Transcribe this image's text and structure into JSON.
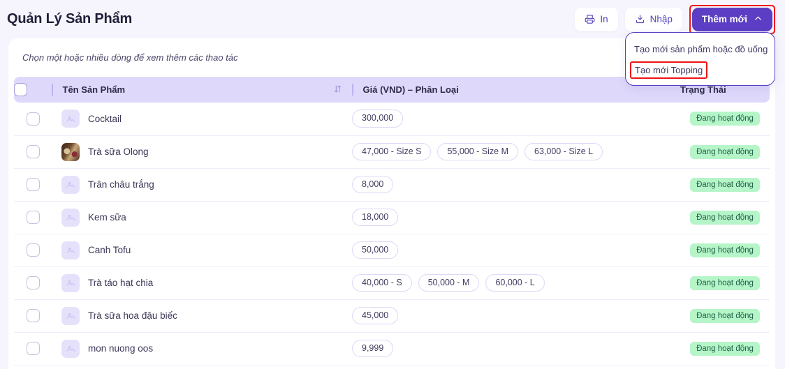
{
  "header": {
    "title": "Quản Lý Sản Phẩm",
    "print_label": "In",
    "import_label": "Nhập",
    "add_new_label": "Thêm mới"
  },
  "dropdown": {
    "items": [
      {
        "label": "Tạo mới sản phẩm hoặc đồ uống",
        "highlighted": false
      },
      {
        "label": "Tạo mới Topping",
        "highlighted": true
      }
    ]
  },
  "card": {
    "hint": "Chọn một hoặc nhiều dòng để xem thêm các thao tác"
  },
  "table": {
    "columns": {
      "name": "Tên Sản Phẩm",
      "price": "Giá (VND) – Phân Loại",
      "status": "Trạng Thái"
    },
    "rows": [
      {
        "name": "Cocktail",
        "thumb": "placeholder",
        "prices": [
          "300,000"
        ],
        "status": "Đang hoạt động"
      },
      {
        "name": "Trà sữa Olong",
        "thumb": "photo",
        "prices": [
          "47,000 - Size S",
          "55,000 - Size M",
          "63,000 - Size L"
        ],
        "status": "Đang hoạt động"
      },
      {
        "name": "Trân châu trắng",
        "thumb": "placeholder",
        "prices": [
          "8,000"
        ],
        "status": "Đang hoạt động"
      },
      {
        "name": "Kem sữa",
        "thumb": "placeholder",
        "prices": [
          "18,000"
        ],
        "status": "Đang hoạt động"
      },
      {
        "name": "Canh Tofu",
        "thumb": "placeholder",
        "prices": [
          "50,000"
        ],
        "status": "Đang hoạt động"
      },
      {
        "name": "Trà táo hạt chia",
        "thumb": "placeholder",
        "prices": [
          "40,000 - S",
          "50,000 - M",
          "60,000 - L"
        ],
        "status": "Đang hoạt động"
      },
      {
        "name": "Trà sữa hoa đậu biếc",
        "thumb": "placeholder",
        "prices": [
          "45,000"
        ],
        "status": "Đang hoạt động"
      },
      {
        "name": "mon nuong oos",
        "thumb": "placeholder",
        "prices": [
          "9,999"
        ],
        "status": "Đang hoạt động"
      }
    ]
  },
  "colors": {
    "accent": "#5b3ec4",
    "header_row": "#ded9fb",
    "badge_bg": "#b5f5c8",
    "annotation": "#ef1414"
  }
}
